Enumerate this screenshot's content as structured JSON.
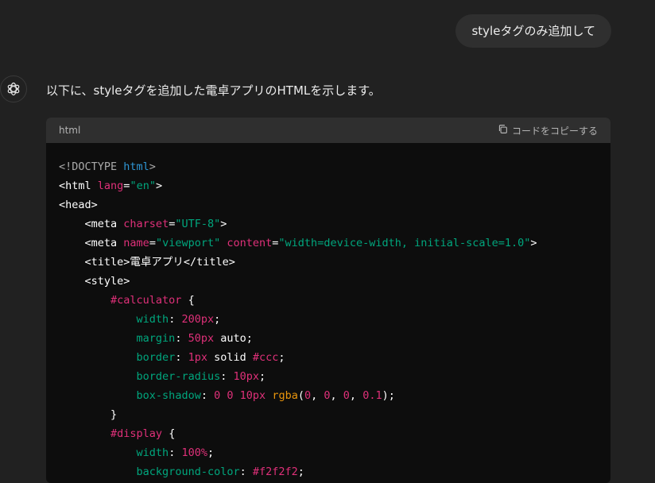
{
  "user_message": "styleタグのみ追加して",
  "assistant": {
    "intro": "以下に、styleタグを追加した電卓アプリのHTMLを示します。",
    "avatar_icon": "openai-logo-icon"
  },
  "code_block": {
    "language": "html",
    "copy_label": "コードをコピーする",
    "lines": [
      "<!DOCTYPE html>",
      "<html lang=\"en\">",
      "<head>",
      "    <meta charset=\"UTF-8\">",
      "    <meta name=\"viewport\" content=\"width=device-width, initial-scale=1.0\">",
      "    <title>電卓アプリ</title>",
      "    <style>",
      "        #calculator {",
      "            width: 200px;",
      "            margin: 50px auto;",
      "            border: 1px solid #ccc;",
      "            border-radius: 10px;",
      "            box-shadow: 0 0 10px rgba(0, 0, 0, 0.1);",
      "        }",
      "        #display {",
      "            width: 100%;",
      "            background-color: #f2f2f2;"
    ]
  },
  "colors": {
    "background": "#212121",
    "code_bg": "#0d0d0d",
    "code_header_bg": "#2f2f2f",
    "selector_pink": "#df3079",
    "property_green": "#00a67d",
    "keyword_blue": "#2e95d3",
    "function_orange": "#e9950c"
  }
}
